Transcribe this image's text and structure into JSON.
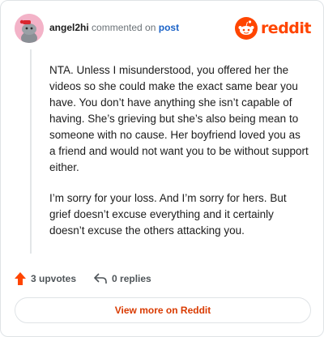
{
  "header": {
    "username": "angel2hi",
    "action_text": "commented on",
    "post_link": "post",
    "logo_text": "reddit"
  },
  "comment": {
    "paragraphs": [
      "NTA. Unless I misunderstood, you offered her the videos so she could make the exact same bear you have. You don’t have anything she isn’t capable of having. She’s grieving but she’s also being mean to someone with no cause. Her boyfriend loved you as a friend and would not want you to be without support either.",
      "I’m sorry for your loss. And I’m sorry for hers. But grief doesn’t excuse everything and it certainly doesn’t excuse the others attacking you."
    ]
  },
  "actions": {
    "upvotes": "3 upvotes",
    "replies": "0 replies"
  },
  "footer": {
    "view_more": "View more on Reddit"
  },
  "icons": {
    "avatar": "snoo-avatar-icon",
    "logo": "reddit-logo-icon",
    "upvote": "upvote-arrow-icon",
    "reply": "reply-arrow-icon"
  },
  "colors": {
    "brand": "#ff4500",
    "link": "#1a62c7",
    "cta": "#d93a00",
    "avatar_bg": "#f3b3c8"
  }
}
